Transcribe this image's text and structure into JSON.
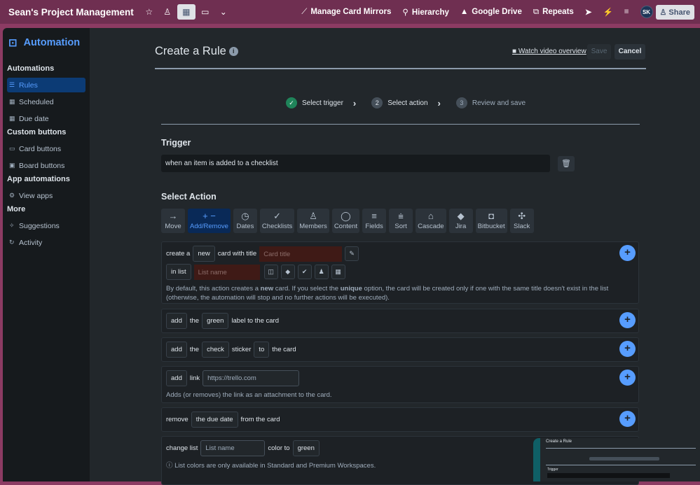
{
  "topbar": {
    "board_title": "Sean's Project Management",
    "items": [
      {
        "icon": "mirror-icon",
        "label": "Manage Card Mirrors"
      },
      {
        "icon": "hierarchy-icon",
        "label": "Hierarchy"
      },
      {
        "icon": "google-drive-icon",
        "label": "Google Drive"
      },
      {
        "icon": "repeat-icon",
        "label": "Repeats"
      }
    ],
    "avatar": "SK",
    "share": "Share"
  },
  "sidebar": {
    "title": "Automation",
    "sections": [
      {
        "label": "Automations",
        "items": [
          {
            "label": "Rules",
            "icon": "sliders-icon",
            "active": true
          },
          {
            "label": "Scheduled",
            "icon": "calendar-icon"
          },
          {
            "label": "Due date",
            "icon": "calendar-icon"
          }
        ]
      },
      {
        "label": "Custom buttons",
        "items": [
          {
            "label": "Card buttons",
            "icon": "card-icon"
          },
          {
            "label": "Board buttons",
            "icon": "board-icon"
          }
        ]
      },
      {
        "label": "App automations",
        "items": [
          {
            "label": "View apps",
            "icon": "gear-icon"
          }
        ]
      },
      {
        "label": "More",
        "items": [
          {
            "label": "Suggestions",
            "icon": "sparkle-icon"
          },
          {
            "label": "Activity",
            "icon": "refresh-icon"
          }
        ]
      }
    ]
  },
  "header": {
    "title": "Create a Rule",
    "video": "Watch video overview",
    "save": "Save",
    "cancel": "Cancel"
  },
  "steps": [
    {
      "num": "✓",
      "label": "Select trigger"
    },
    {
      "num": "2",
      "label": "Select action"
    },
    {
      "num": "3",
      "label": "Review and save"
    }
  ],
  "trigger": {
    "heading": "Trigger",
    "value": "when an item is added to a checklist"
  },
  "select_action": {
    "heading": "Select Action",
    "tabs": [
      {
        "icon": "→",
        "label": "Move"
      },
      {
        "icon": "+ −",
        "label": "Add/Remove",
        "selected": true
      },
      {
        "icon": "◷",
        "label": "Dates"
      },
      {
        "icon": "✓",
        "label": "Checklists"
      },
      {
        "icon": "♙",
        "label": "Members"
      },
      {
        "icon": "◯",
        "label": "Content"
      },
      {
        "icon": "≡",
        "label": "Fields"
      },
      {
        "icon": "⩧",
        "label": "Sort"
      },
      {
        "icon": "⌂",
        "label": "Cascade"
      },
      {
        "icon": "◆",
        "label": "Jira"
      },
      {
        "icon": "◘",
        "label": "Bitbucket"
      },
      {
        "icon": "✣",
        "label": "Slack"
      }
    ]
  },
  "cards": {
    "c1": {
      "t1": "create a",
      "new": "new",
      "t2": "card with title",
      "title_ph": "Card title",
      "in_list": "in list",
      "list_ph": "List name",
      "note_a": "By default, this action creates a ",
      "note_b": "new",
      "note_c": " card. If you select the ",
      "note_d": "unique",
      "note_e": " option, the card will be created only if one with the same title doesn't exist in the list (otherwise, the automation will stop and no further actions will be executed)."
    },
    "c2": {
      "add": "add",
      "the": "the",
      "color": "green",
      "rest": "label to the card"
    },
    "c3": {
      "add": "add",
      "the": "the",
      "sticker": "check",
      "t": "sticker",
      "to": "to",
      "rest": "the card"
    },
    "c4": {
      "add": "add",
      "link": "link",
      "url_ph": "https://trello.com",
      "note": "Adds (or removes) the link as an attachment to the card."
    },
    "c5": {
      "remove": "remove",
      "what": "the due date",
      "rest": "from the card"
    },
    "c6": {
      "t1": "change list",
      "list_ph": "List name",
      "t2": "color to",
      "color": "green",
      "note": "List colors are only available in Standard and Premium Workspaces."
    }
  },
  "thumbnail": {
    "title": "Create a Rule",
    "trigger_label": "Trigger"
  }
}
